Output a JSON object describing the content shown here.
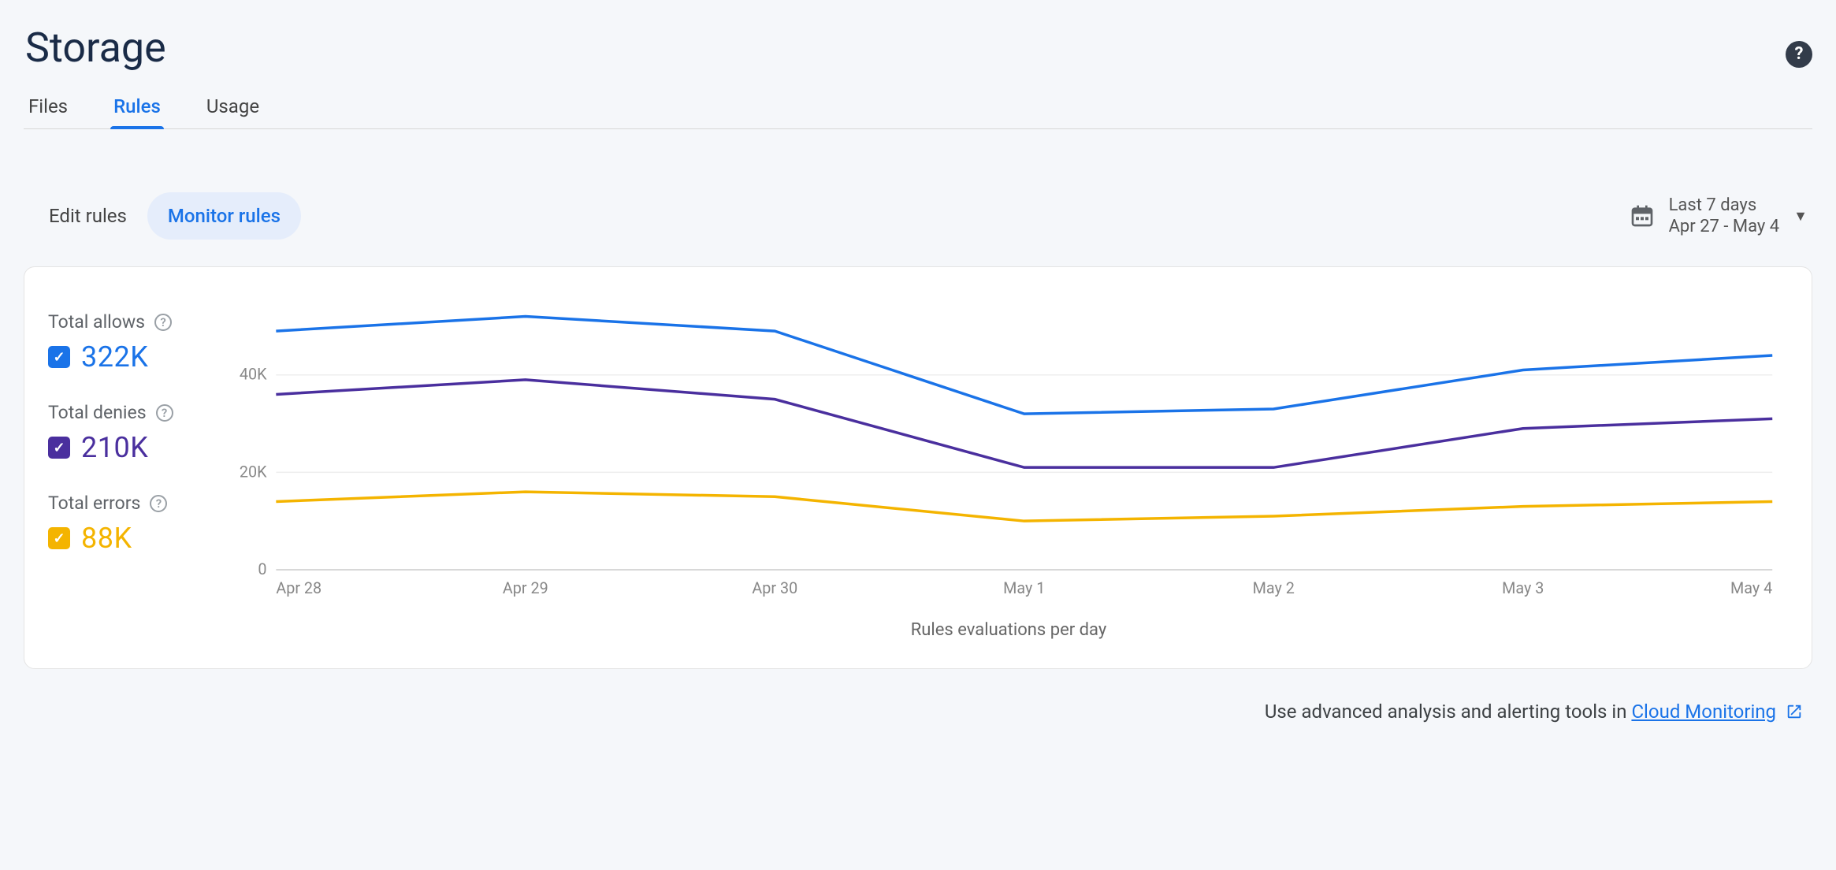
{
  "page": {
    "title": "Storage"
  },
  "tabs": {
    "files": "Files",
    "rules": "Rules",
    "usage": "Usage",
    "active": "rules"
  },
  "modes": {
    "edit": "Edit rules",
    "monitor": "Monitor rules",
    "active": "monitor"
  },
  "date_picker": {
    "label": "Last 7 days",
    "range": "Apr 27 - May 4"
  },
  "legend": {
    "allows": {
      "label": "Total allows",
      "value": "322K",
      "color": "#1a73e8"
    },
    "denies": {
      "label": "Total denies",
      "value": "210K",
      "color": "#4a2f9e"
    },
    "errors": {
      "label": "Total errors",
      "value": "88K",
      "color": "#f4b400"
    }
  },
  "footer": {
    "text": "Use advanced analysis and alerting tools in ",
    "link_text": "Cloud Monitoring"
  },
  "chart_data": {
    "type": "line",
    "title": "",
    "xlabel": "Rules evaluations per day",
    "ylabel": "",
    "ylim": [
      0,
      55000
    ],
    "yticks": [
      0,
      20000,
      40000
    ],
    "ytick_labels": [
      "0",
      "20K",
      "40K"
    ],
    "categories": [
      "Apr 28",
      "Apr 29",
      "Apr 30",
      "May 1",
      "May 2",
      "May 3",
      "May 4"
    ],
    "series": [
      {
        "name": "Total allows",
        "color": "#1a73e8",
        "values": [
          49000,
          52000,
          49000,
          32000,
          33000,
          41000,
          44000
        ]
      },
      {
        "name": "Total denies",
        "color": "#4a2f9e",
        "values": [
          36000,
          39000,
          35000,
          21000,
          21000,
          29000,
          31000
        ]
      },
      {
        "name": "Total errors",
        "color": "#f4b400",
        "values": [
          14000,
          16000,
          15000,
          10000,
          11000,
          13000,
          14000
        ]
      }
    ]
  }
}
